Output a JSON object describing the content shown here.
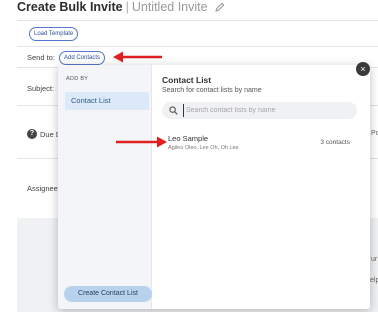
{
  "header": {
    "title": "Create Bulk Invite",
    "separator": "|",
    "subtitle": "Untitled Invite"
  },
  "toolbar": {
    "load_template_label": "Load Template",
    "send_to_label": "Send to:",
    "add_contacts_label": "Add Contacts"
  },
  "form": {
    "subject_label": "Subject:",
    "due_label": "Due D",
    "assignee_label": "Assignee:",
    "right_fragment_1": "Po",
    "right_fragment_2": "ur",
    "right_fragment_3": "elp"
  },
  "modal": {
    "sidebar": {
      "heading": "ADD BY",
      "items": [
        {
          "label": "Contact List",
          "selected": true
        }
      ],
      "create_button_label": "Create Contact List"
    },
    "main": {
      "title": "Contact List",
      "description": "Search for contact lists by name",
      "search_placeholder": "Search contact lists by name",
      "search_value": "",
      "lists": [
        {
          "name": "Leo Sample",
          "members": "Agileo Oleo, Lee Oh, Oh Lee",
          "count": "3 contacts"
        }
      ]
    },
    "close_label": "×"
  },
  "colors": {
    "accent": "#2f5d8a",
    "pill_border": "#5577cc",
    "arrow": "#e02020",
    "selected_bg": "#dbe9f8",
    "button_bg": "#b8d2ee"
  },
  "icons": [
    "pencil-icon",
    "help-icon",
    "search-icon",
    "close-icon",
    "arrow-icon"
  ]
}
